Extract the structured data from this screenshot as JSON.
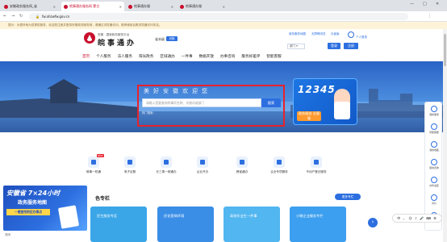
{
  "browser": {
    "tabs": [
      {
        "title": "安徽政务服务网_省",
        "active": false
      },
      {
        "title": "皖事通办服务网 蒙古",
        "active": true
      },
      {
        "title": "皖事通办服",
        "active": false
      },
      {
        "title": "皖事通办服",
        "active": false
      }
    ],
    "url": "fw.ahzwfw.gov.cn",
    "controls": {
      "minimize": "—",
      "maximize": "□",
      "close": "✕"
    }
  },
  "notice": "提示：为更好地为您提供服务，欢迎您注册并登录安徽政务服务网，请通过浏览器访问，推荐使用谷歌浏览器访问本站。",
  "header": {
    "logo_subtitle": "安徽 · 国家政务服务平台",
    "logo_title": "皖事通办",
    "region": "省本级",
    "region_btn": "切换",
    "links": [
      "政务服务地图",
      "无障碍浏览",
      "长者版"
    ],
    "login_label": "个人登录",
    "select_label": "部门 ▾",
    "btn_login": "登录",
    "btn_register": "注册"
  },
  "nav": [
    "首页",
    "个人服务",
    "法人服务",
    "阳光政务",
    "区域通办",
    "一件事",
    "数据开放",
    "办事咨询",
    "服务好差评",
    "智能客服"
  ],
  "hero": {
    "title": "美好安徽欢迎您",
    "search_placeholder": "请输入您要查询的事项名称、关键词或部门",
    "search_button": "搜索",
    "hot_words": "热门搜索：",
    "promo_number": "12345",
    "promo_tag": "政务服务 总客服"
  },
  "services": [
    {
      "label": "皖事一机通",
      "new": true
    },
    {
      "label": "电子证照",
      "new": false
    },
    {
      "label": "长三角一网通办",
      "new": false
    },
    {
      "label": "企业开办",
      "new": false
    },
    {
      "label": "跨省通办",
      "new": false
    },
    {
      "label": "企业专项服务",
      "new": false
    },
    {
      "label": "不动产登记服务",
      "new": false
    }
  ],
  "section": {
    "title": "色专栏",
    "more": "更多专栏"
  },
  "cards": [
    {
      "title": "民生服务专区",
      "color": "#3aa6e8"
    },
    {
      "title": "优化营商环境",
      "color": "#3a8ee6"
    },
    {
      "title": "高校毕业生一件事",
      "color": "#52b6f0"
    },
    {
      "title": "小微企业服务专栏",
      "color": "#3c9fef"
    }
  ],
  "ad": {
    "headline": "安徽省 7×24小时",
    "headline2": "政务服务地图",
    "sub": "一键查找附近办事点",
    "close": "关闭"
  },
  "float_bar": [
    "我的事项",
    "智能客服",
    "我的收藏",
    "留言咨询",
    "办件进度",
    "评价",
    "返回顶部"
  ],
  "bottom_toolbar": "中 ， ☺ ♪ 🎤 ⌨ ⚙"
}
